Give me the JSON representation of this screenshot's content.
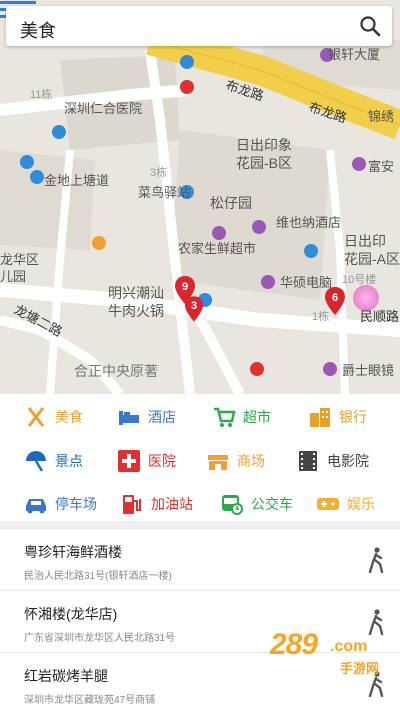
{
  "search": {
    "query": "美食"
  },
  "map": {
    "labels": {
      "tl_block": "11栋",
      "hospital": "深圳仁合医院",
      "road_bulong": "布龙路",
      "road_bulong2": "布龙路",
      "yinxuan": "银轩大厦",
      "jinshui": "锦绣",
      "riri_b1": "日出印象",
      "riri_b2": "花园-B区",
      "fugui": "富安",
      "caoniao": "菜鸟驿站",
      "songzi": "松仔园",
      "jindi": "金地上塘道",
      "b3": "3栋",
      "weiye": "维也纳酒店",
      "nongjia": "农家生鲜超市",
      "riri_a1": "日出印",
      "riri_a2": "花园-A区",
      "longhua1": "龙华区",
      "longhua2": "儿园",
      "huaqiang": "华硕电脑",
      "b10": "10号楼",
      "mingxing1": "明兴潮汕",
      "mingxing2": "牛肉火锅",
      "road_longtang": "龙塘二路",
      "b1": "1栋",
      "minshun": "民顺路",
      "hezheng": "合正中央原著",
      "jueshi": "爵士眼镜"
    },
    "markers": [
      "9",
      "3",
      "6"
    ]
  },
  "categories": [
    {
      "label": "美食",
      "icon": "food-icon",
      "color": "#f0a030"
    },
    {
      "label": "酒店",
      "icon": "hotel-icon",
      "color": "#3a78c8"
    },
    {
      "label": "超市",
      "icon": "cart-icon",
      "color": "#2aa84a"
    },
    {
      "label": "银行",
      "icon": "bank-icon",
      "color": "#e8a02a"
    },
    {
      "label": "景点",
      "icon": "umbrella-icon",
      "color": "#1a6bb8"
    },
    {
      "label": "医院",
      "icon": "hospital-icon",
      "color": "#e03030"
    },
    {
      "label": "商场",
      "icon": "mall-icon",
      "color": "#f0a030"
    },
    {
      "label": "电影院",
      "icon": "film-icon",
      "color": "#444444"
    },
    {
      "label": "停车场",
      "icon": "parking-icon",
      "color": "#3a78c8"
    },
    {
      "label": "加油站",
      "icon": "fuel-icon",
      "color": "#e03030"
    },
    {
      "label": "公交车",
      "icon": "bus-icon",
      "color": "#2aa84a"
    },
    {
      "label": "娱乐",
      "icon": "game-icon",
      "color": "#f0b030"
    }
  ],
  "results": [
    {
      "name": "粤珍轩海鲜酒楼",
      "address": "民治人民北路31号(银轩酒店一楼)"
    },
    {
      "name": "怀湘楼(龙华店)",
      "address": "广东省深圳市龙华区人民北路31号"
    },
    {
      "name": "红岩碳烤羊腿",
      "address": "深圳市龙华区藏珑苑47号商铺"
    }
  ],
  "watermark": {
    "number": "289",
    "suffix": ".com",
    "sub": "手游网"
  },
  "colors": {
    "map_bg": "#e8e5df",
    "road_yellow": "#f5d24a",
    "marker": "#d9262c",
    "poi_blue": "#2f8cd8",
    "poi_purple": "#9b59b6"
  }
}
